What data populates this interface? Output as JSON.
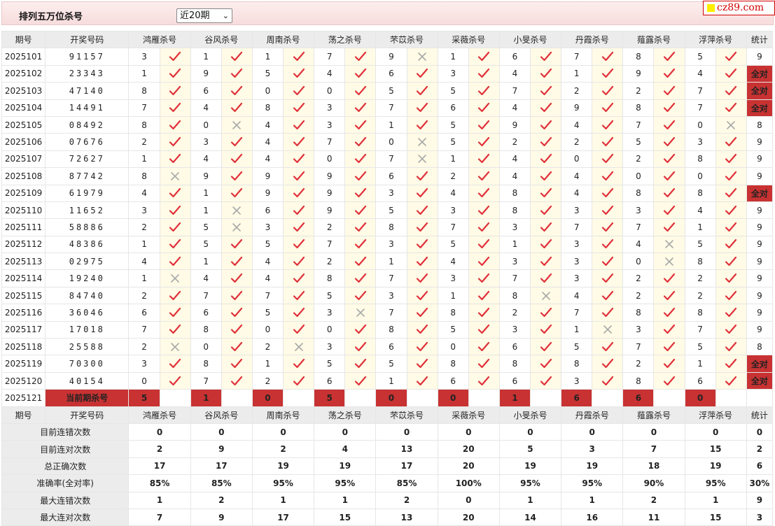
{
  "title": "排列五万位杀号",
  "period_select": "近20期",
  "logo": "cz89.com",
  "headers": [
    "期号",
    "开奖号码",
    "鸿雁杀号",
    "谷风杀号",
    "周南杀号",
    "荡之杀号",
    "芣苡杀号",
    "采薇杀号",
    "小旻杀号",
    "丹霞杀号",
    "薤露杀号",
    "浮萍杀号",
    "统计"
  ],
  "all_correct_label": "全对",
  "rows": [
    {
      "period": "2025101",
      "draw": "91157",
      "kills": [
        3,
        1,
        1,
        7,
        9,
        1,
        6,
        7,
        8,
        5
      ],
      "ok": [
        1,
        1,
        1,
        1,
        0,
        1,
        1,
        1,
        1,
        1
      ],
      "stat": "9"
    },
    {
      "period": "2025102",
      "draw": "23343",
      "kills": [
        1,
        9,
        5,
        4,
        6,
        3,
        4,
        1,
        9,
        4
      ],
      "ok": [
        1,
        1,
        1,
        1,
        1,
        1,
        1,
        1,
        1,
        1
      ],
      "stat": "全对"
    },
    {
      "period": "2025103",
      "draw": "47140",
      "kills": [
        8,
        6,
        0,
        0,
        5,
        5,
        7,
        2,
        2,
        7
      ],
      "ok": [
        1,
        1,
        1,
        1,
        1,
        1,
        1,
        1,
        1,
        1
      ],
      "stat": "全对"
    },
    {
      "period": "2025104",
      "draw": "14491",
      "kills": [
        7,
        4,
        8,
        3,
        7,
        6,
        4,
        9,
        8,
        7
      ],
      "ok": [
        1,
        1,
        1,
        1,
        1,
        1,
        1,
        1,
        1,
        1
      ],
      "stat": "全对"
    },
    {
      "period": "2025105",
      "draw": "08492",
      "kills": [
        8,
        0,
        4,
        3,
        1,
        5,
        9,
        4,
        7,
        0
      ],
      "ok": [
        1,
        0,
        1,
        1,
        1,
        1,
        1,
        1,
        1,
        0
      ],
      "stat": "8"
    },
    {
      "period": "2025106",
      "draw": "07676",
      "kills": [
        2,
        3,
        4,
        7,
        0,
        5,
        2,
        2,
        5,
        3
      ],
      "ok": [
        1,
        1,
        1,
        1,
        0,
        1,
        1,
        1,
        1,
        1
      ],
      "stat": "9"
    },
    {
      "period": "2025107",
      "draw": "72627",
      "kills": [
        1,
        4,
        4,
        0,
        7,
        1,
        4,
        0,
        2,
        8
      ],
      "ok": [
        1,
        1,
        1,
        1,
        0,
        1,
        1,
        1,
        1,
        1
      ],
      "stat": "9"
    },
    {
      "period": "2025108",
      "draw": "87742",
      "kills": [
        8,
        9,
        9,
        9,
        6,
        2,
        4,
        4,
        0,
        0
      ],
      "ok": [
        0,
        1,
        1,
        1,
        1,
        1,
        1,
        1,
        1,
        1
      ],
      "stat": "9"
    },
    {
      "period": "2025109",
      "draw": "61979",
      "kills": [
        4,
        1,
        9,
        9,
        3,
        4,
        8,
        4,
        8,
        8
      ],
      "ok": [
        1,
        1,
        1,
        1,
        1,
        1,
        1,
        1,
        1,
        1
      ],
      "stat": "全对"
    },
    {
      "period": "2025110",
      "draw": "11652",
      "kills": [
        3,
        1,
        6,
        9,
        5,
        3,
        8,
        3,
        3,
        4
      ],
      "ok": [
        1,
        0,
        1,
        1,
        1,
        1,
        1,
        1,
        1,
        1
      ],
      "stat": "9"
    },
    {
      "period": "2025111",
      "draw": "58886",
      "kills": [
        2,
        5,
        3,
        2,
        8,
        7,
        3,
        7,
        7,
        1
      ],
      "ok": [
        1,
        0,
        1,
        1,
        1,
        1,
        1,
        1,
        1,
        1
      ],
      "stat": "9"
    },
    {
      "period": "2025112",
      "draw": "48386",
      "kills": [
        1,
        5,
        5,
        7,
        3,
        5,
        1,
        3,
        4,
        5
      ],
      "ok": [
        1,
        1,
        1,
        1,
        1,
        1,
        1,
        1,
        0,
        1
      ],
      "stat": "9"
    },
    {
      "period": "2025113",
      "draw": "02975",
      "kills": [
        4,
        1,
        4,
        2,
        1,
        4,
        3,
        3,
        0,
        8
      ],
      "ok": [
        1,
        1,
        1,
        1,
        1,
        1,
        1,
        1,
        0,
        1
      ],
      "stat": "9"
    },
    {
      "period": "2025114",
      "draw": "19240",
      "kills": [
        1,
        4,
        4,
        8,
        7,
        3,
        7,
        3,
        2,
        2
      ],
      "ok": [
        0,
        1,
        1,
        1,
        1,
        1,
        1,
        1,
        1,
        1
      ],
      "stat": "9"
    },
    {
      "period": "2025115",
      "draw": "84740",
      "kills": [
        2,
        7,
        7,
        5,
        3,
        1,
        8,
        4,
        2,
        2
      ],
      "ok": [
        1,
        1,
        1,
        1,
        1,
        1,
        0,
        1,
        1,
        1
      ],
      "stat": "9"
    },
    {
      "period": "2025116",
      "draw": "36046",
      "kills": [
        6,
        6,
        5,
        3,
        7,
        8,
        2,
        7,
        8,
        8
      ],
      "ok": [
        1,
        1,
        1,
        0,
        1,
        1,
        1,
        1,
        1,
        1
      ],
      "stat": "9"
    },
    {
      "period": "2025117",
      "draw": "17018",
      "kills": [
        7,
        8,
        0,
        0,
        8,
        5,
        3,
        1,
        3,
        7
      ],
      "ok": [
        1,
        1,
        1,
        1,
        1,
        1,
        1,
        0,
        1,
        1
      ],
      "stat": "9"
    },
    {
      "period": "2025118",
      "draw": "25588",
      "kills": [
        2,
        0,
        2,
        3,
        6,
        0,
        6,
        5,
        7,
        5
      ],
      "ok": [
        0,
        1,
        0,
        1,
        1,
        1,
        1,
        1,
        1,
        1
      ],
      "stat": "8"
    },
    {
      "period": "2025119",
      "draw": "70300",
      "kills": [
        3,
        8,
        1,
        5,
        5,
        8,
        8,
        8,
        2,
        1
      ],
      "ok": [
        1,
        1,
        1,
        1,
        1,
        1,
        1,
        1,
        1,
        1
      ],
      "stat": "全对"
    },
    {
      "period": "2025120",
      "draw": "40154",
      "kills": [
        0,
        7,
        2,
        6,
        1,
        6,
        6,
        3,
        8,
        6
      ],
      "ok": [
        1,
        1,
        1,
        1,
        1,
        1,
        1,
        1,
        1,
        1
      ],
      "stat": "全对"
    }
  ],
  "current": {
    "period": "2025121",
    "label": "当前期杀号",
    "kills": [
      5,
      1,
      0,
      5,
      0,
      0,
      1,
      6,
      6,
      0
    ]
  },
  "summary_header": [
    "期号",
    "开奖号码",
    "鸿雁杀号",
    "谷风杀号",
    "周南杀号",
    "荡之杀号",
    "芣苡杀号",
    "采薇杀号",
    "小旻杀号",
    "丹霞杀号",
    "薤露杀号",
    "浮萍杀号",
    "统计"
  ],
  "summary": [
    {
      "label": "目前连错次数",
      "values": [
        "0",
        "0",
        "0",
        "0",
        "0",
        "0",
        "0",
        "0",
        "0",
        "0",
        "0"
      ],
      "style": "blue"
    },
    {
      "label": "目前连对次数",
      "values": [
        "2",
        "9",
        "2",
        "4",
        "13",
        "20",
        "5",
        "3",
        "7",
        "15",
        "2"
      ],
      "style": "blue"
    },
    {
      "label": "总正确次数",
      "values": [
        "17",
        "17",
        "19",
        "19",
        "17",
        "20",
        "19",
        "19",
        "18",
        "19",
        "6"
      ],
      "style": "blue"
    },
    {
      "label": "准确率(全对率)",
      "values": [
        "85%",
        "85%",
        "95%",
        "95%",
        "85%",
        "100%",
        "95%",
        "95%",
        "90%",
        "95%",
        "30%"
      ],
      "style": "red"
    },
    {
      "label": "最大连错次数",
      "values": [
        "1",
        "2",
        "1",
        "1",
        "2",
        "0",
        "1",
        "1",
        "2",
        "1",
        "9"
      ],
      "style": "blue"
    },
    {
      "label": "最大连对次数",
      "values": [
        "7",
        "9",
        "17",
        "15",
        "13",
        "20",
        "14",
        "16",
        "11",
        "15",
        "3"
      ],
      "style": "blue"
    }
  ]
}
